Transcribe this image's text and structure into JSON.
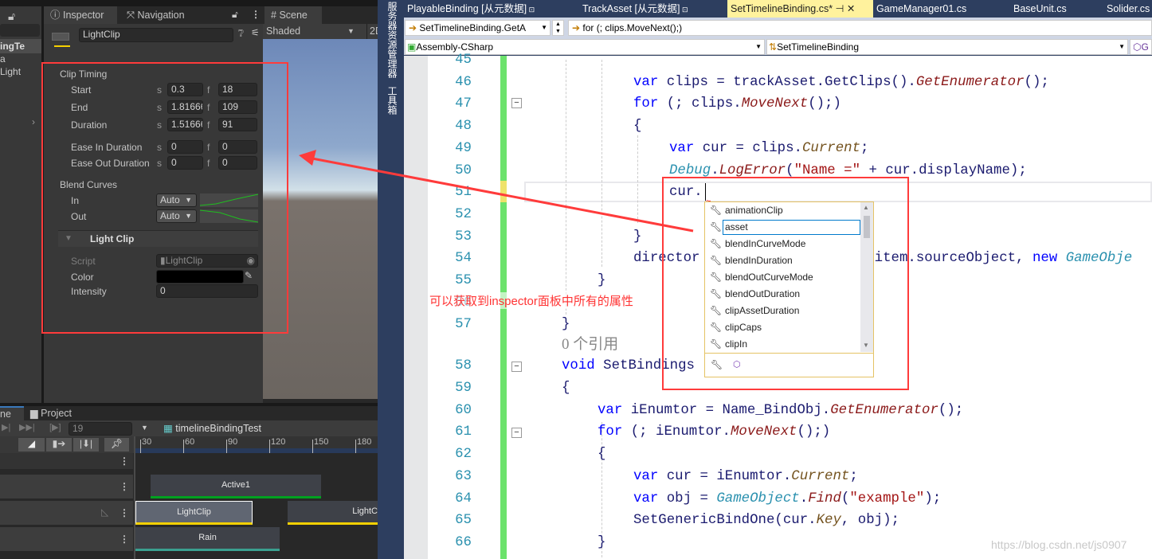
{
  "unity": {
    "hierarchy": {
      "items": [
        "ingTe",
        "a",
        "Light"
      ]
    },
    "tabs": {
      "inspector": "Inspector",
      "navigation": "Navigation",
      "scene": "Scene"
    },
    "scene": {
      "shading": "Shaded",
      "mode": "2D"
    },
    "object_name": "LightClip",
    "clip_timing": {
      "title": "Clip Timing",
      "rows": [
        {
          "label": "Start",
          "s": "0.3",
          "f": "18"
        },
        {
          "label": "End",
          "s": "1.81666",
          "f": "109"
        },
        {
          "label": "Duration",
          "s": "1.51666",
          "f": "91"
        },
        {
          "label": "Ease In Duration",
          "s": "0",
          "f": "0"
        },
        {
          "label": "Ease Out Duration",
          "s": "0",
          "f": "0"
        }
      ],
      "s_unit": "s",
      "f_unit": "f"
    },
    "blend_curves": {
      "title": "Blend Curves",
      "in_label": "In",
      "in_value": "Auto",
      "out_label": "Out",
      "out_value": "Auto"
    },
    "light_clip": {
      "title": "Light Clip",
      "script_label": "Script",
      "script_value": "LightClip",
      "color_label": "Color",
      "color_value": "#000000",
      "intensity_label": "Intensity",
      "intensity_value": "0"
    },
    "timeline": {
      "tab_timeline": "ne",
      "tab_project": "Project",
      "frame": "19",
      "asset": "timelineBindingTest",
      "ruler": [
        "30",
        "60",
        "90",
        "120",
        "150",
        "180"
      ],
      "clips": {
        "active": "Active1",
        "light": "LightClip",
        "light2": "LightC",
        "rain": "Rain"
      }
    }
  },
  "vs": {
    "side_tabs": [
      "服务器资源管理器",
      "工具箱"
    ],
    "tabs": [
      {
        "label": "PlayableBinding [从元数据]",
        "active": false
      },
      {
        "label": "TrackAsset [从元数据]",
        "active": false
      },
      {
        "label": "SetTimelineBinding.cs*",
        "active": true
      },
      {
        "label": "GameManager01.cs",
        "active": false
      },
      {
        "label": "BaseUnit.cs",
        "active": false
      },
      {
        "label": "Solider.cs",
        "active": false
      }
    ],
    "nav_member": "SetTimelineBinding.GetA",
    "nav_location": "for (; clips.MoveNext();)",
    "project": "Assembly-CSharp",
    "class": "SetTimelineBinding",
    "references": "0 个引用",
    "lines": [
      {
        "n": "45",
        "tokens": []
      },
      {
        "n": "46",
        "tokens": [
          [
            "            ",
            ""
          ],
          [
            "var",
            "kw"
          ],
          [
            " clips = trackAsset.GetClips().",
            ""
          ],
          [
            "GetEnumerator",
            "mr"
          ],
          [
            "();",
            ""
          ]
        ]
      },
      {
        "n": "47",
        "tokens": [
          [
            "            ",
            ""
          ],
          [
            "for",
            "kw"
          ],
          [
            " (; clips.",
            ""
          ],
          [
            "MoveNext",
            "mr"
          ],
          [
            "();)",
            ""
          ]
        ]
      },
      {
        "n": "48",
        "tokens": [
          [
            "            ",
            ""
          ],
          [
            "{",
            ""
          ]
        ]
      },
      {
        "n": "49",
        "tokens": [
          [
            "                ",
            ""
          ],
          [
            "var",
            "kw"
          ],
          [
            " cur = clips.",
            ""
          ],
          [
            "Current",
            "me"
          ],
          [
            ";",
            ""
          ]
        ]
      },
      {
        "n": "50",
        "tokens": [
          [
            "                ",
            ""
          ],
          [
            "Debug",
            "ty"
          ],
          [
            ".",
            ""
          ],
          [
            "LogError",
            "mr"
          ],
          [
            "(",
            ""
          ],
          [
            "\"Name =\"",
            "st"
          ],
          [
            " + cur.displayName);",
            ""
          ]
        ]
      },
      {
        "n": "51",
        "tokens": [
          [
            "                ",
            ""
          ],
          [
            "cur.",
            ""
          ]
        ]
      },
      {
        "n": "52",
        "tokens": []
      },
      {
        "n": "53",
        "tokens": [
          [
            "            ",
            ""
          ],
          [
            "}",
            ""
          ]
        ]
      },
      {
        "n": "54",
        "tokens": [
          [
            "            ",
            ""
          ],
          [
            "director                     item.sourceObject, ",
            ""
          ],
          [
            "new",
            "kw"
          ],
          [
            " ",
            ""
          ],
          [
            "GameObje",
            "ty"
          ]
        ]
      },
      {
        "n": "55",
        "tokens": [
          [
            "        ",
            ""
          ],
          [
            "}",
            ""
          ]
        ]
      },
      {
        "n": "56",
        "tokens": []
      },
      {
        "n": "57",
        "tokens": [
          [
            "    ",
            ""
          ],
          [
            "}",
            ""
          ]
        ]
      },
      {
        "n": "58",
        "tokens": [
          [
            "    ",
            ""
          ],
          [
            "void",
            "kw"
          ],
          [
            " SetBindings",
            ""
          ]
        ]
      },
      {
        "n": "59",
        "tokens": [
          [
            "    ",
            ""
          ],
          [
            "{",
            ""
          ]
        ]
      },
      {
        "n": "60",
        "tokens": [
          [
            "        ",
            ""
          ],
          [
            "var",
            "kw"
          ],
          [
            " iEnumtor = Name_BindObj.",
            ""
          ],
          [
            "GetEnumerator",
            "mr"
          ],
          [
            "();",
            ""
          ]
        ]
      },
      {
        "n": "61",
        "tokens": [
          [
            "        ",
            ""
          ],
          [
            "for",
            "kw"
          ],
          [
            " (; iEnumtor.",
            ""
          ],
          [
            "MoveNext",
            "mr"
          ],
          [
            "();)",
            ""
          ]
        ]
      },
      {
        "n": "62",
        "tokens": [
          [
            "        ",
            ""
          ],
          [
            "{",
            ""
          ]
        ]
      },
      {
        "n": "63",
        "tokens": [
          [
            "            ",
            ""
          ],
          [
            "var",
            "kw"
          ],
          [
            " cur = iEnumtor.",
            ""
          ],
          [
            "Current",
            "me"
          ],
          [
            ";",
            ""
          ]
        ]
      },
      {
        "n": "64",
        "tokens": [
          [
            "            ",
            ""
          ],
          [
            "var",
            "kw"
          ],
          [
            " obj = ",
            ""
          ],
          [
            "GameObject",
            "ty"
          ],
          [
            ".",
            ""
          ],
          [
            "Find",
            "mr"
          ],
          [
            "(",
            ""
          ],
          [
            "\"example\"",
            "st"
          ],
          [
            ");",
            ""
          ]
        ]
      },
      {
        "n": "65",
        "tokens": [
          [
            "            ",
            ""
          ],
          [
            "SetGenericBindOne(cur.",
            ""
          ],
          [
            "Key",
            "me"
          ],
          [
            ", obj);",
            ""
          ]
        ]
      },
      {
        "n": "66",
        "tokens": [
          [
            "        ",
            ""
          ],
          [
            "}",
            ""
          ]
        ]
      }
    ],
    "completion": {
      "items": [
        "animationClip",
        "asset",
        "blendInCurveMode",
        "blendInDuration",
        "blendOutCurveMode",
        "blendOutDuration",
        "clipAssetDuration",
        "clipCaps",
        "clipIn"
      ],
      "selected": "asset",
      "icon": "wrench-icon"
    }
  },
  "annotation": {
    "text": "可以获取到inspector面板中所有的属性",
    "color": "#ff3333"
  },
  "watermark": "https://blog.csdn.net/js0907"
}
